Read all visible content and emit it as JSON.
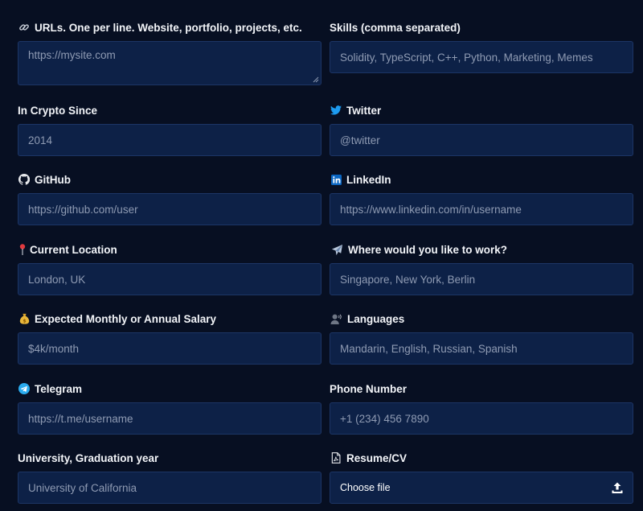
{
  "fields": {
    "urls": {
      "label": "URLs. One per line. Website, portfolio, projects, etc.",
      "value": "https://mysite.com"
    },
    "skills": {
      "label": "Skills (comma separated)",
      "placeholder": "Solidity, TypeScript, C++, Python, Marketing, Memes"
    },
    "crypto_since": {
      "label": "In Crypto Since",
      "placeholder": "2014"
    },
    "twitter": {
      "label": "Twitter",
      "placeholder": "@twitter"
    },
    "github": {
      "label": "GitHub",
      "placeholder": "https://github.com/user"
    },
    "linkedin": {
      "label": "LinkedIn",
      "placeholder": "https://www.linkedin.com/in/username"
    },
    "location": {
      "label": "Current Location",
      "placeholder": "London, UK"
    },
    "work_where": {
      "label": "Where would you like to work?",
      "placeholder": "Singapore, New York, Berlin"
    },
    "salary": {
      "label": "Expected Monthly or Annual Salary",
      "placeholder": "$4k/month"
    },
    "languages": {
      "label": "Languages",
      "placeholder": "Mandarin, English, Russian, Spanish"
    },
    "telegram": {
      "label": "Telegram",
      "placeholder": "https://t.me/username"
    },
    "phone": {
      "label": "Phone Number",
      "placeholder": "+1 (234) 456 7890"
    },
    "university": {
      "label": "University, Graduation year",
      "placeholder": "University of California"
    },
    "resume": {
      "label": "Resume/CV",
      "button_text": "Choose file"
    }
  },
  "icons": {
    "urls": "link-icon",
    "twitter": "twitter-icon",
    "github": "github-icon",
    "linkedin": "linkedin-icon",
    "location": "pushpin-icon",
    "work_where": "airplane-icon",
    "salary": "money-bag-icon",
    "languages": "speaking-head-icon",
    "telegram": "telegram-icon",
    "resume": "pdf-file-icon",
    "upload": "upload-icon"
  },
  "colors": {
    "background": "#070f22",
    "input_bg": "#0d2147",
    "input_border": "#1c3565",
    "label_text": "#f2f4f8",
    "placeholder_text": "#8f9bb3",
    "twitter_blue": "#1d9bf0",
    "linkedin_blue": "#0a66c2",
    "telegram_blue": "#2aabee"
  }
}
